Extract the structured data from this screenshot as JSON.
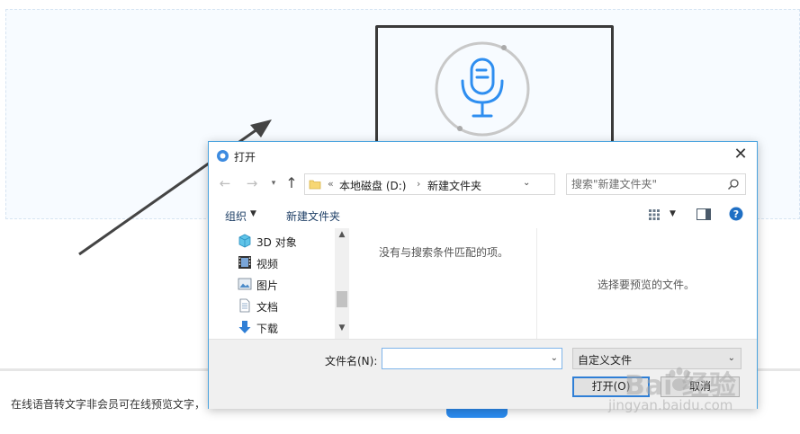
{
  "page": {
    "footer_text": "在线语音转文字非会员可在线预览文字，"
  },
  "dialog": {
    "title": "打开",
    "close_label": "✕",
    "address": {
      "overflow": "«",
      "segment_1": "本地磁盘 (D:)",
      "separator": "›",
      "segment_2": "新建文件夹"
    },
    "search_placeholder": "搜索\"新建文件夹\"",
    "toolbar": {
      "organize": "组织",
      "new_folder": "新建文件夹"
    },
    "nav_items": [
      {
        "label": "3D 对象",
        "icon": "3d-objects-icon"
      },
      {
        "label": "视频",
        "icon": "video-icon"
      },
      {
        "label": "图片",
        "icon": "pictures-icon"
      },
      {
        "label": "文档",
        "icon": "documents-icon"
      },
      {
        "label": "下载",
        "icon": "downloads-icon"
      }
    ],
    "empty_message": "没有与搜索条件匹配的项。",
    "preview_message": "选择要预览的文件。",
    "filename_label": "文件名(N):",
    "filename_value": "",
    "file_type": "自定义文件",
    "open_button": "打开(O)",
    "cancel_button": "取消"
  },
  "watermark": {
    "brand": "Bai   经验",
    "url": "jingyan.baidu.com"
  },
  "colors": {
    "accent_blue": "#2b8cf0",
    "mic_blue": "#2e8ef0",
    "annotation_dark": "#3a3a3a",
    "dialog_border": "#4aa3df"
  }
}
